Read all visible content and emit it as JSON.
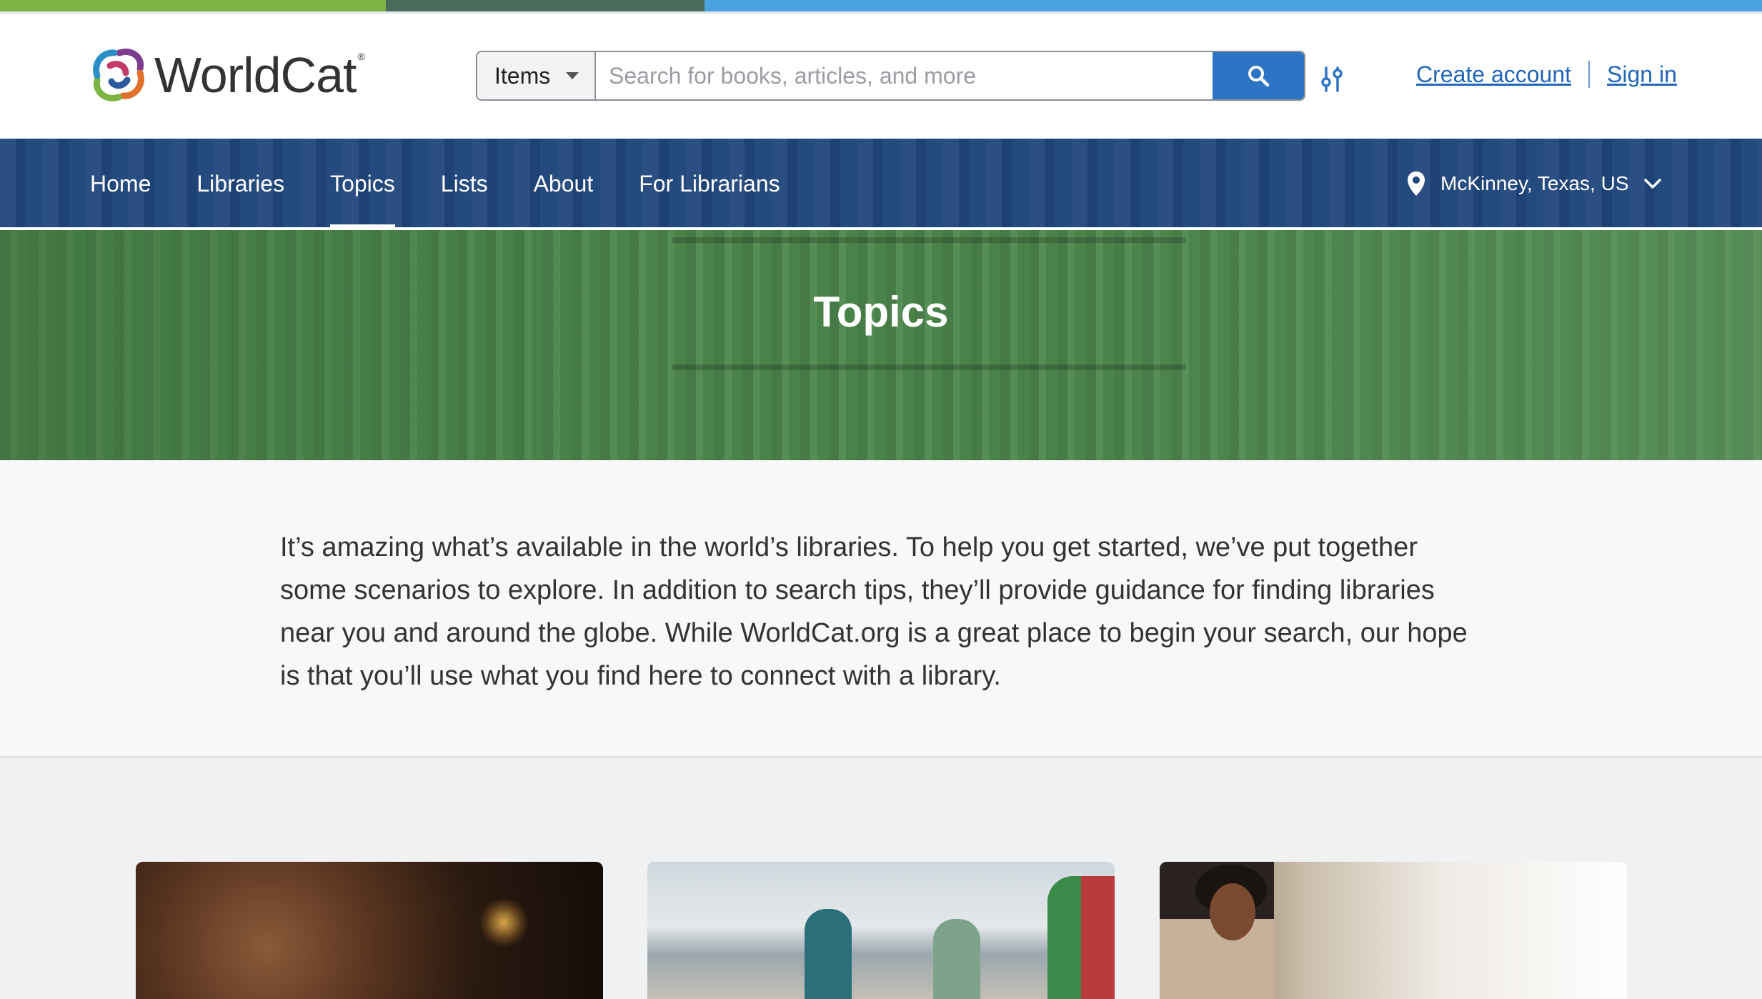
{
  "header": {
    "logo_text": "WorldCat",
    "logo_reg": "®",
    "search_type": "Items",
    "search_placeholder": "Search for books, articles, and more",
    "create_account": "Create account",
    "sign_in": "Sign in"
  },
  "nav": {
    "items": [
      {
        "label": "Home",
        "active": false
      },
      {
        "label": "Libraries",
        "active": false
      },
      {
        "label": "Topics",
        "active": true
      },
      {
        "label": "Lists",
        "active": false
      },
      {
        "label": "About",
        "active": false
      },
      {
        "label": "For Librarians",
        "active": false
      }
    ],
    "location": "McKinney, Texas, US"
  },
  "hero": {
    "title": "Topics"
  },
  "intro": {
    "text": "It’s amazing what’s available in the world’s libraries. To help you get started, we’ve put together some scenarios to explore. In addition to search tips, they’ll provide guidance for finding libraries near you and around the globe. While WorldCat.org is a great place to begin your search, our hope is that you’ll use what you find here to connect with a library."
  },
  "colors": {
    "accent_blue": "#2d74c4",
    "nav_blue": "#21467c",
    "hero_green": "#4f8a4f",
    "link_blue": "#2067b8"
  }
}
